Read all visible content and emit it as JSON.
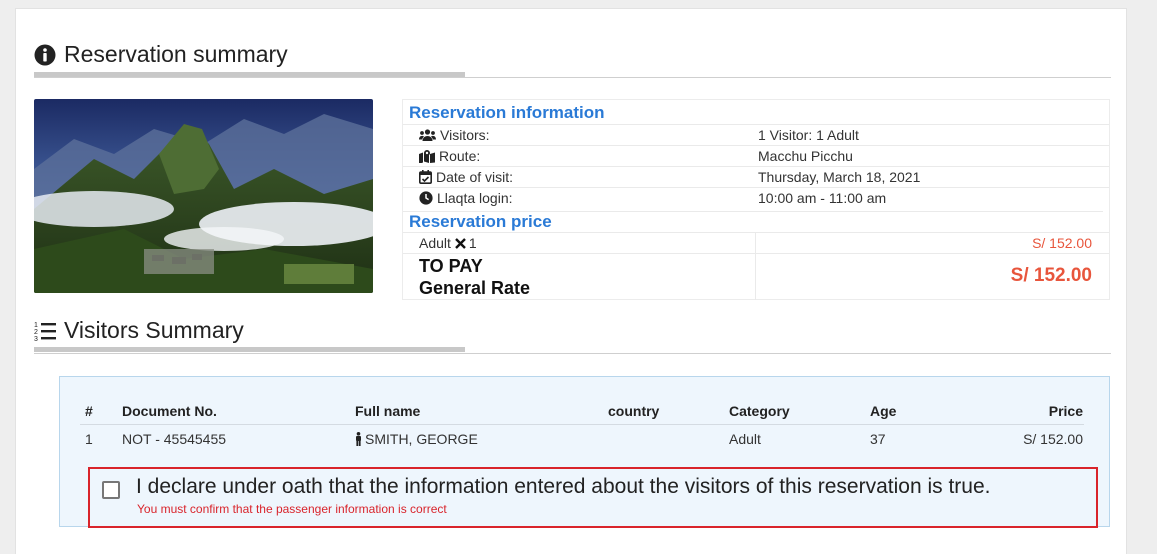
{
  "reservation_summary": {
    "title": "Reservation summary"
  },
  "reservation_info": {
    "heading": "Reservation information",
    "rows": [
      {
        "label": "Visitors:",
        "value": "1 Visitor: 1 Adult"
      },
      {
        "label": "Route:",
        "value": "Macchu Picchu"
      },
      {
        "label": "Date of visit:",
        "value": "Thursday, March 18, 2021"
      },
      {
        "label": "Llaqta login:",
        "value": "10:00 am - 11:00 am"
      }
    ]
  },
  "reservation_price": {
    "heading": "Reservation price",
    "line_label": "Adult",
    "line_qty": "1",
    "line_price": "S/ 152.00",
    "to_pay": "TO PAY",
    "rate": "General Rate",
    "total": "S/ 152.00"
  },
  "visitors_summary": {
    "title": "Visitors Summary",
    "columns": [
      "#",
      "Document No.",
      "Full name",
      "country",
      "Category",
      "Age",
      "Price"
    ],
    "rows": [
      {
        "num": "1",
        "document": "NOT - 45545455",
        "name": "SMITH, GEORGE",
        "country": "",
        "category": "Adult",
        "age": "37",
        "price": "S/ 152.00"
      }
    ]
  },
  "declaration": {
    "text": "I declare under oath that the information entered about the visitors of this reservation is true.",
    "error": "You must confirm that the passenger information is correct",
    "checked": false
  },
  "colors": {
    "accent_blue": "#2a7ad6",
    "price_red": "#e8553c",
    "error_red": "#d9242b"
  }
}
